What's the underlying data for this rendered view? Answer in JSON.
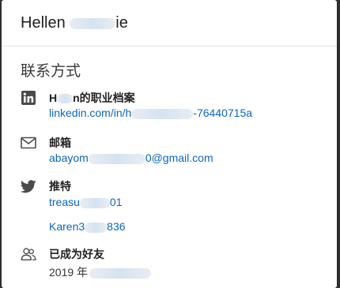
{
  "header": {
    "name_prefix": "Hellen ",
    "name_suffix": "ie"
  },
  "section": {
    "title": "联系方式"
  },
  "linkedin": {
    "icon": "linkedin-icon",
    "label_prefix": "H",
    "label_suffix": "n的职业档案",
    "url_prefix": "linkedin.com/in/h",
    "url_suffix": "-76440715a"
  },
  "email": {
    "icon": "envelope-icon",
    "label": "邮箱",
    "value_prefix": "abayom",
    "value_suffix": "0@gmail.com"
  },
  "twitter": {
    "icon": "twitter-icon",
    "label": "推特",
    "handle1_prefix": "treasu",
    "handle1_suffix": "01",
    "handle2_prefix": "Karen3",
    "handle2_suffix": "836"
  },
  "connected": {
    "icon": "people-icon",
    "label": "已成为好友",
    "date_prefix": "2019 年"
  },
  "colors": {
    "link": "#0a66c2",
    "icon": "#4a4a4a"
  }
}
